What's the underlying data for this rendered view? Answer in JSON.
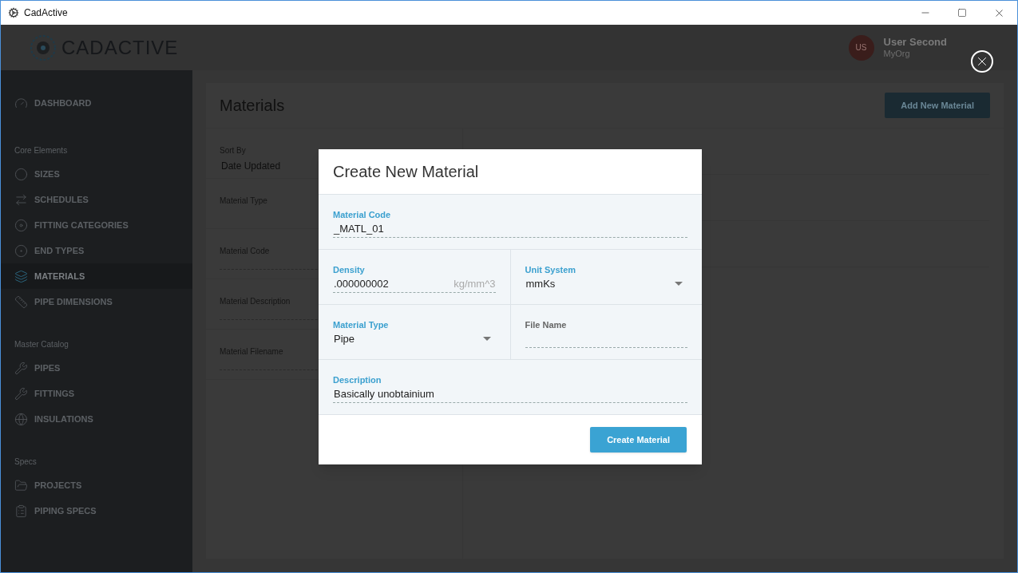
{
  "window": {
    "title": "CadActive"
  },
  "header": {
    "logo_text": "CADACTIVE",
    "user": {
      "initials": "US",
      "name": "User Second",
      "org": "MyOrg"
    }
  },
  "sidebar": {
    "groups": [
      {
        "items": [
          {
            "label": "DASHBOARD",
            "selected": false
          }
        ]
      },
      {
        "heading": "Core Elements",
        "items": [
          {
            "label": "SIZES",
            "selected": false
          },
          {
            "label": "SCHEDULES",
            "selected": false
          },
          {
            "label": "FITTING CATEGORIES",
            "selected": false
          },
          {
            "label": "END TYPES",
            "selected": false
          },
          {
            "label": "MATERIALS",
            "selected": true
          },
          {
            "label": "PIPE DIMENSIONS",
            "selected": false
          }
        ]
      },
      {
        "heading": "Master Catalog",
        "items": [
          {
            "label": "PIPES",
            "selected": false
          },
          {
            "label": "FITTINGS",
            "selected": false
          },
          {
            "label": "INSULATIONS",
            "selected": false
          }
        ]
      },
      {
        "heading": "Specs",
        "items": [
          {
            "label": "PROJECTS",
            "selected": false
          },
          {
            "label": "PIPING SPECS",
            "selected": false
          }
        ]
      }
    ]
  },
  "page": {
    "title": "Materials",
    "add_button": "Add New Material",
    "filters": [
      {
        "kind": "select",
        "label": "Sort By",
        "value": "Date Updated"
      },
      {
        "kind": "select",
        "label": "Material Type"
      },
      {
        "kind": "text",
        "label": "Material Code"
      },
      {
        "kind": "text",
        "label": "Material Description"
      },
      {
        "kind": "text",
        "label": "Material Filename"
      }
    ]
  },
  "dialog": {
    "title": "Create New Material",
    "rows": [
      [
        {
          "kind": "text",
          "label": "Material Code",
          "value": "_MATL_01"
        }
      ],
      [
        {
          "kind": "text",
          "label": "Density",
          "value": ".000000002",
          "unit": "kg/mm^3"
        },
        {
          "kind": "select",
          "label": "Unit System",
          "value": "mmKs"
        }
      ],
      [
        {
          "kind": "select",
          "label": "Material Type",
          "value": "Pipe"
        },
        {
          "kind": "text",
          "label": "File Name"
        }
      ],
      [
        {
          "kind": "text",
          "label": "Description",
          "value": "Basically unobtainium"
        }
      ]
    ],
    "submit": "Create Material"
  }
}
